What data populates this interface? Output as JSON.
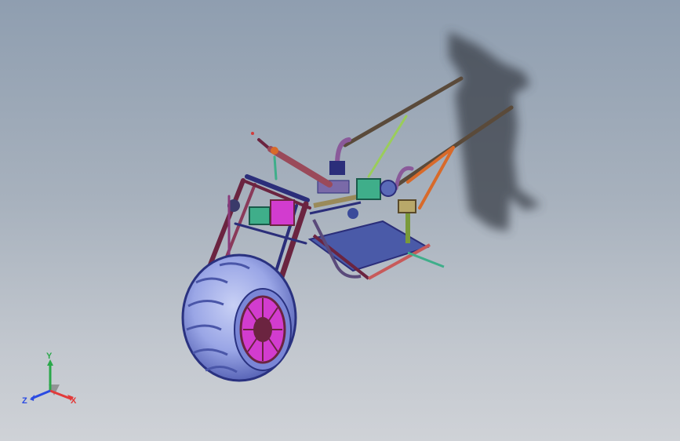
{
  "viewport": {
    "background_top": "#8f9eb0",
    "background_bottom": "#cfd2d7"
  },
  "model": {
    "icon": "atv-chassis-3d-model",
    "colors": {
      "tire": "#9aa6e6",
      "tire_dark": "#4a56a8",
      "rim": "#d23ccf",
      "frame_navy": "#2b2e7a",
      "frame_maroon": "#6b2440",
      "frame_orange": "#d86a2a",
      "frame_green": "#3fae8a",
      "frame_lime": "#9acd5a",
      "handle_bar": "#7a5a4a",
      "shadow": "#3a3f4a"
    }
  },
  "triad": {
    "icon": "reference-triad-icon",
    "y_label": "Y",
    "x_label": "X",
    "z_label": "Z",
    "y_color": "#2aa84a",
    "x_color": "#e23a3a",
    "z_color": "#2a4ae2"
  }
}
